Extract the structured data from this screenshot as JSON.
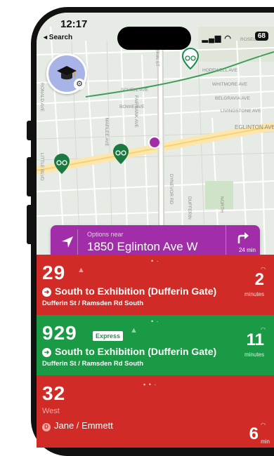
{
  "status": {
    "time": "12:17",
    "back_label": "◂ Search",
    "battery": "68"
  },
  "map": {
    "streets": [
      "HOPEWELL AVE",
      "WHITMORE AVE",
      "BELGRAVIA AVE",
      "LIVINGSTONE AVE",
      "EGLINTON AVE",
      "SCHELL AVE",
      "BOWIE AVE",
      "DUFFERIN ST",
      "FAIRBANK AVE",
      "MARLEE AVE",
      "DYNEVOR RD",
      "RONALD AVE",
      "LITTLE BLVD",
      "DUFFERIN",
      "NORTH",
      "ROSELAN"
    ]
  },
  "search": {
    "label": "Options near",
    "address": "1850 Eglinton Ave W",
    "eta": "24 min"
  },
  "cards": [
    {
      "route": "29",
      "dest": "South to Exhibition (Dufferin Gate)",
      "stop": "Dufferin St / Ramsden Rd South",
      "minutes": "2",
      "minutes_label": "minutes"
    },
    {
      "route": "929",
      "badge": "Express",
      "dest": "South to Exhibition (Dufferin Gate)",
      "stop": "Dufferin St / Ramsden Rd South",
      "minutes": "11",
      "minutes_label": "minutes"
    },
    {
      "route": "32",
      "direction": "West",
      "dest_icon": "D",
      "dest": "Jane / Emmett",
      "minutes": "6",
      "minutes_label": "min"
    }
  ],
  "colors": {
    "red": "#d02b26",
    "green": "#1a9a45",
    "purple": "#a12ea8"
  }
}
